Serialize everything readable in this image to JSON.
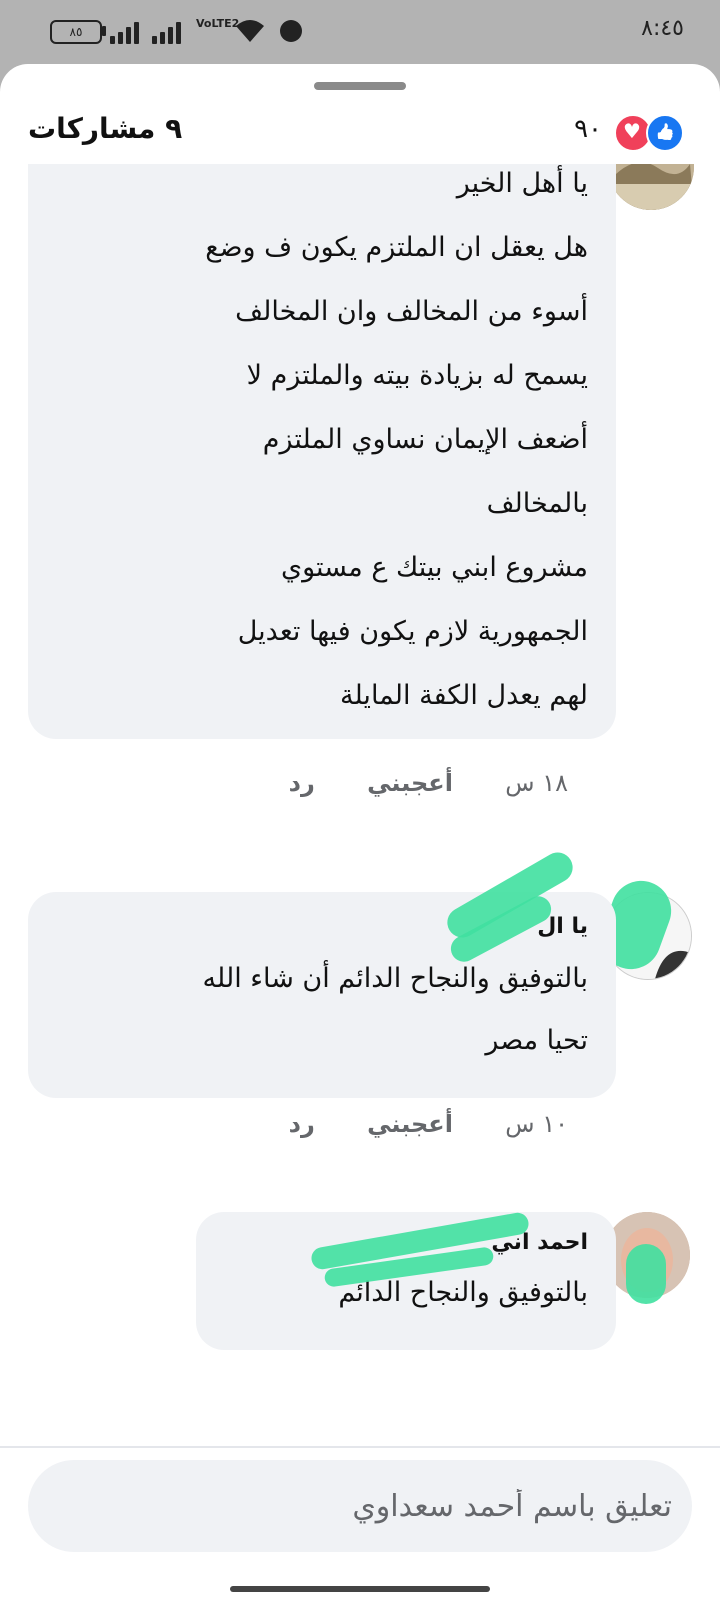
{
  "status_bar": {
    "time": "٨:٤٥",
    "battery": "٨٥",
    "network": "VoLTE2",
    "icons": [
      "battery-icon",
      "signal-icon",
      "signal-icon-2",
      "volte-icon",
      "wifi-icon",
      "alarm-icon"
    ]
  },
  "header": {
    "shares": "٩ مشاركات",
    "reactions_count": "٩٠",
    "reaction_icons": [
      "love-icon",
      "like-icon"
    ]
  },
  "comments": [
    {
      "author": "",
      "text": "يا أهل الخير\nهل يعقل ان الملتزم يكون ف وضع\nأسوء من المخالف وان المخالف\nيسمح له بزيادة بيته والملتزم لا\nأضعف الإيمان نساوي الملتزم\nبالمخالف\nمشروع ابني بيتك ع مستوي\nالجمهورية  لازم يكون فيها تعديل\nلهم يعدل الكفة المايلة",
      "time": "١٨ س",
      "like": "أعجبني",
      "reply": "رد"
    },
    {
      "author": "يا          ال",
      "text": "بالتوفيق والنجاح الدائم أن شاء الله\nتحيا مصر",
      "time": "١٠ س",
      "like": "أعجبني",
      "reply": "رد"
    },
    {
      "author": "احمد          اني",
      "text": "بالتوفيق والنجاح الدائم"
    }
  ],
  "composer": {
    "placeholder": "تعليق باسم أحمد سعداوي"
  },
  "colors": {
    "bubble": "#f0f2f5",
    "like_blue": "#1877f2",
    "love_red": "#f0405a",
    "redaction": "#40e0a0"
  }
}
